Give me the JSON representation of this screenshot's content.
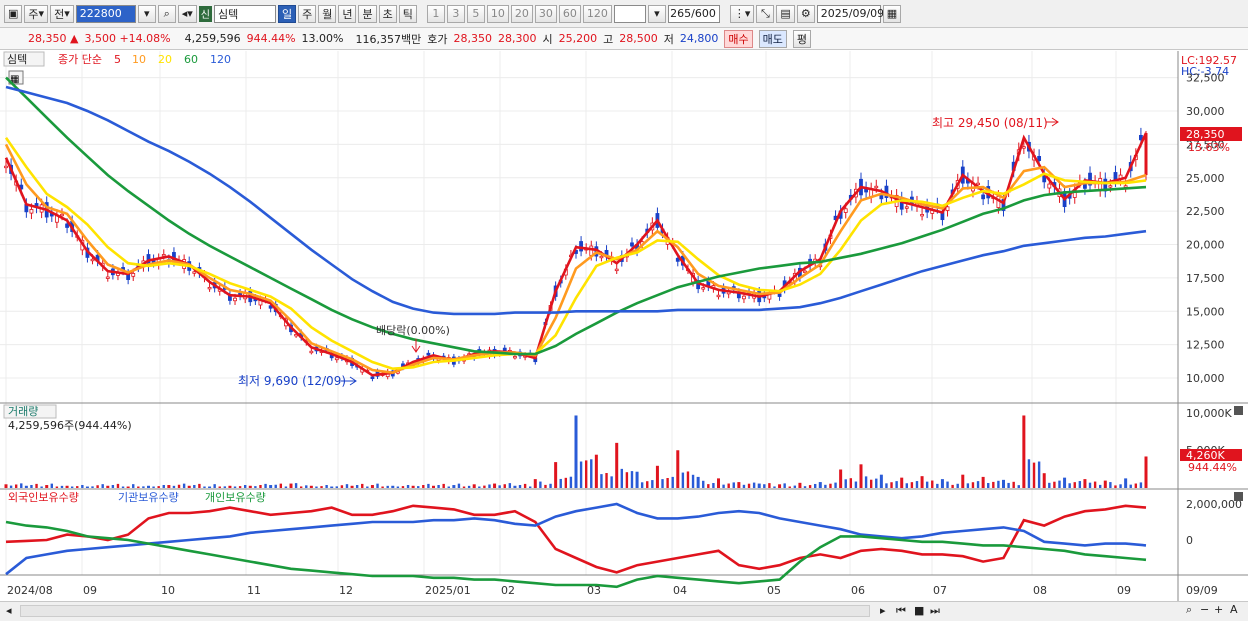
{
  "toolbar": {
    "tabs": [
      "주",
      "전"
    ],
    "code": "222800",
    "type_badge": "신",
    "name": "심텍",
    "periods": [
      "일",
      "주",
      "월",
      "년",
      "분",
      "초",
      "틱"
    ],
    "active_period": "일",
    "intervals": [
      "1",
      "3",
      "5",
      "10",
      "20",
      "30",
      "60",
      "120"
    ],
    "count": "265",
    "count_total": "/600",
    "date": "2025/09/09"
  },
  "quote": {
    "price": "28,350 ▲",
    "change": "3,500 +14.08%",
    "volume": "4,259,596",
    "vol_pct": "944.44%",
    "turnover": "13.00%",
    "amount": "116,357백만",
    "bid_label": "호가",
    "ask": "28,350",
    "bid": "28,300",
    "open_label": "시",
    "open": "25,200",
    "high_label": "고",
    "high": "28,500",
    "low_label": "저",
    "low": "24,800",
    "buy_label": "매수",
    "sell_label": "매도",
    "eval_label": "평"
  },
  "price_panel": {
    "title": "심텍",
    "ma_label": "종가 단순",
    "ma_periods": [
      "5",
      "10",
      "20",
      "60",
      "120"
    ],
    "ma_colors": [
      "#e0141e",
      "#ff9a1f",
      "#ffe300",
      "#1a9a3c",
      "#2a5bd7"
    ],
    "lc": "LC:192.57",
    "hc": "HC:-3.74",
    "high_note": "최고 29,450 (08/11)",
    "low_note": "최저 9,690 (12/09)",
    "dividend_note": "배당락(0.00%)",
    "last_price": "28,350",
    "last_pct": "13.63%",
    "yticks": [
      "32,500",
      "30,000",
      "27,500",
      "25,000",
      "22,500",
      "20,000",
      "17,500",
      "15,000",
      "12,500",
      "10,000"
    ]
  },
  "volume_panel": {
    "title": "거래량",
    "value": "4,259,596주(944.44%)",
    "yticks": [
      "10,000K",
      "5,000K"
    ],
    "last": "4,260K",
    "last_pct": "944.44%"
  },
  "holder_panel": {
    "series": [
      "외국인보유수량",
      "기관보유수량",
      "개인보유수량"
    ],
    "yticks": [
      "2,000,000",
      "0"
    ]
  },
  "x_labels": [
    "2024/08",
    "09",
    "10",
    "11",
    "12",
    "2025/01",
    "02",
    "03",
    "04",
    "05",
    "06",
    "07",
    "08",
    "09"
  ],
  "x_end": "09/09",
  "chart_data": {
    "type": "line",
    "title": "심텍",
    "ylim": [
      9000,
      33500
    ],
    "ma_series": [
      {
        "name": "5",
        "values": [
          26500,
          23000,
          22600,
          21800,
          19500,
          18000,
          17800,
          18800,
          19100,
          18500,
          17200,
          16200,
          16100,
          15600,
          13800,
          12300,
          11800,
          11200,
          10200,
          10400,
          11200,
          11700,
          11300,
          11800,
          12000,
          11900,
          11500,
          16500,
          19800,
          19600,
          18600,
          20000,
          21800,
          19200,
          17100,
          16600,
          16400,
          16100,
          16500,
          18000,
          18900,
          22500,
          24300,
          24000,
          23200,
          22800,
          22400,
          25200,
          24000,
          23100,
          28000,
          25300,
          23400,
          24800,
          24600,
          25000,
          28350
        ]
      },
      {
        "name": "10",
        "values": [
          27500,
          24500,
          22800,
          22300,
          20300,
          18500,
          17900,
          18500,
          18800,
          18500,
          17500,
          16600,
          16300,
          15800,
          14300,
          12600,
          12000,
          11400,
          10600,
          10400,
          11000,
          11500,
          11400,
          11700,
          11900,
          11900,
          11700,
          14500,
          18200,
          19400,
          18900,
          19600,
          21000,
          19800,
          17800,
          16900,
          16600,
          16300,
          16400,
          17500,
          18500,
          21000,
          23300,
          23800,
          23500,
          23000,
          22700,
          24200,
          24300,
          23500,
          25500,
          25800,
          24300,
          24600,
          24600,
          24700,
          25200
        ]
      },
      {
        "name": "20",
        "values": [
          28000,
          25800,
          23800,
          22800,
          21500,
          19800,
          18600,
          18400,
          18600,
          18400,
          17800,
          17100,
          16600,
          16100,
          15200,
          13800,
          12800,
          12000,
          11200,
          10700,
          10800,
          11200,
          11300,
          11500,
          11700,
          11800,
          11800,
          13200,
          16000,
          18400,
          19000,
          19400,
          20300,
          20200,
          18900,
          17700,
          17000,
          16600,
          16500,
          17000,
          17800,
          19600,
          21800,
          23000,
          23300,
          23200,
          22900,
          23500,
          24000,
          23800,
          24500,
          25300,
          24800,
          24700,
          24600,
          24600,
          24800
        ]
      },
      {
        "name": "60",
        "values": [
          32500,
          31000,
          29500,
          28000,
          26600,
          25200,
          24000,
          22900,
          21800,
          20800,
          19900,
          19100,
          18300,
          17500,
          16700,
          15900,
          15100,
          14400,
          13800,
          13300,
          12900,
          12600,
          12300,
          12000,
          11900,
          11800,
          11800,
          12400,
          13300,
          14100,
          14900,
          15600,
          16200,
          16800,
          17200,
          17600,
          17900,
          18200,
          18400,
          18600,
          18700,
          19000,
          19300,
          19700,
          20100,
          20600,
          21100,
          21700,
          22300,
          22700,
          23300,
          23700,
          23900,
          24000,
          24100,
          24200,
          24300
        ]
      },
      {
        "name": "120",
        "values": [
          31800,
          31400,
          31000,
          30600,
          30000,
          29300,
          28500,
          27700,
          27000,
          26200,
          25300,
          24300,
          23200,
          22000,
          20800,
          19600,
          18500,
          17400,
          16500,
          15700,
          15200,
          14900,
          14800,
          14800,
          14800,
          14900,
          14900,
          14900,
          15000,
          15000,
          15000,
          15000,
          15000,
          15100,
          15100,
          15100,
          15100,
          15100,
          15200,
          15300,
          15600,
          16000,
          16500,
          17000,
          17500,
          18000,
          18400,
          18800,
          19200,
          19500,
          19900,
          20100,
          20300,
          20500,
          20600,
          20800,
          21000
        ]
      }
    ],
    "volume_values": [
      0.5,
      0.3,
      0.4,
      0.3,
      0.2,
      0.3,
      0.2,
      0.3,
      0.4,
      0.3,
      0.2,
      0.3,
      0.3,
      0.4,
      0.6,
      0.3,
      0.2,
      0.3,
      0.4,
      0.3,
      0.3,
      0.3,
      0.4,
      0.5,
      0.6,
      0.3,
      1.2,
      3.5,
      9.8,
      4.5,
      6.1,
      2.2,
      3.0,
      5.1,
      1.5,
      1.3,
      0.8,
      0.6,
      0.5,
      0.7,
      0.8,
      2.5,
      3.2,
      1.8,
      1.4,
      1.6,
      1.2,
      1.8,
      1.5,
      1.1,
      9.8,
      2.0,
      1.4,
      1.2,
      1.0,
      1.3,
      4.26
    ],
    "foreign_holdings": [
      -0.1,
      -0.05,
      0,
      0.3,
      0.2,
      0,
      0.3,
      1.2,
      1.5,
      1.5,
      1.6,
      1.8,
      1.6,
      1.4,
      1.5,
      1.6,
      1.8,
      1.4,
      1.4,
      1.6,
      1.9,
      1.8,
      1.7,
      1.4,
      1.4,
      1.6,
      1.0,
      -0.5,
      -1.0,
      -1.5,
      -1.8,
      -1.4,
      -1.2,
      -1.0,
      -0.8,
      -0.6,
      -1.4,
      -1.6,
      -1.4,
      -1.0,
      -0.8,
      -1.0,
      -0.6,
      -0.5,
      -0.6,
      -0.8,
      -0.8,
      -0.9,
      -1.2,
      -1.0,
      1.1,
      0.8,
      1.3,
      1.6,
      1.7,
      1.9,
      1.8
    ],
    "institution_holdings": [
      -1.9,
      -1.0,
      -0.8,
      -0.6,
      -0.5,
      -0.4,
      -0.3,
      -0.2,
      -0.1,
      0,
      0.1,
      0.2,
      0.4,
      0.5,
      0.6,
      0.7,
      0.8,
      0.9,
      1.0,
      1.0,
      1.0,
      1.1,
      1.1,
      1.2,
      1.1,
      0.9,
      0.8,
      1.3,
      1.6,
      1.8,
      2.0,
      1.5,
      1.2,
      1.2,
      1.3,
      1.5,
      1.6,
      1.5,
      1.2,
      1.0,
      0.8,
      0.6,
      0.3,
      0.2,
      0.1,
      0.2,
      0.4,
      0.5,
      0.6,
      0.7,
      0.5,
      -0.1,
      -0.2,
      -0.3,
      -0.2,
      -0.2,
      -0.3
    ],
    "individual_holdings": [
      1.0,
      0.8,
      0.7,
      0.5,
      0.2,
      0.1,
      0,
      -0.2,
      -0.4,
      -0.6,
      -0.8,
      -1.0,
      -1.2,
      -1.4,
      -1.6,
      -1.7,
      -1.8,
      -1.9,
      -2.0,
      -2.0,
      -2.0,
      -2.1,
      -2.1,
      -2.2,
      -2.2,
      -2.3,
      -2.4,
      -2.5,
      -2.5,
      -2.5,
      -2.6,
      -2.2,
      -2.0,
      -2.1,
      -2.2,
      -2.3,
      -2.4,
      -2.3,
      -2.2,
      -1.2,
      -0.4,
      0.2,
      0.2,
      0.1,
      0,
      -0.1,
      -0.1,
      -0.2,
      -0.3,
      -0.3,
      -0.4,
      -0.5,
      -0.6,
      -0.8,
      -0.9,
      -1.0,
      -1.1
    ]
  }
}
